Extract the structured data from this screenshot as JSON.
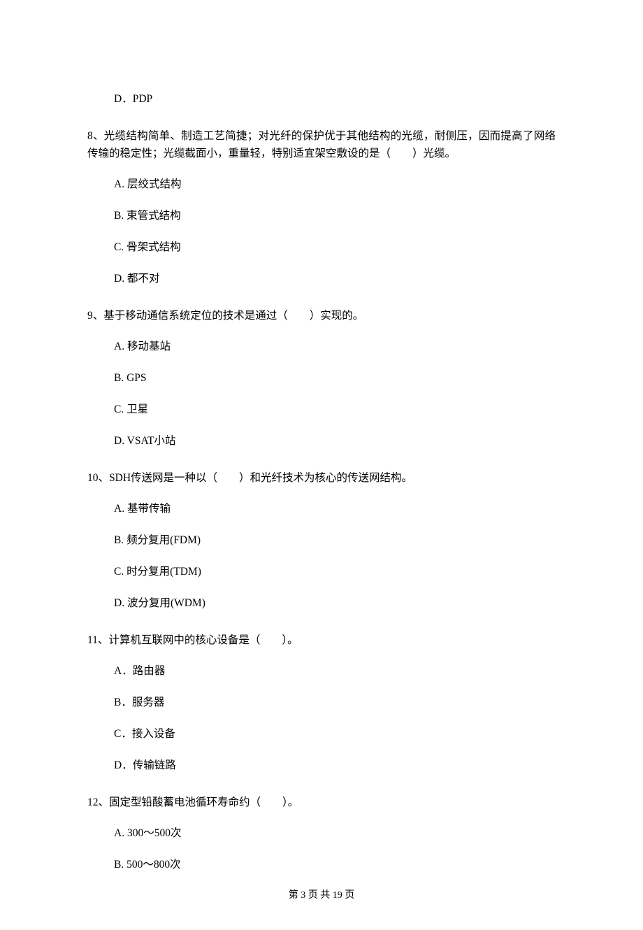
{
  "opt_d_pdp": "D．PDP",
  "q8": "8、光缆结构简单、制造工艺简捷；对光纤的保护优于其他结构的光缆，耐侧压，因而提高了网络传输的稳定性；光缆截面小，重量轻，特别适宜架空敷设的是（　　）光缆。",
  "q8_a": "A. 层绞式结构",
  "q8_b": "B. 束管式结构",
  "q8_c": "C. 骨架式结构",
  "q8_d": "D. 都不对",
  "q9": "9、基于移动通信系统定位的技术是通过（　　）实现的。",
  "q9_a": "A. 移动基站",
  "q9_b": "B. GPS",
  "q9_c": "C. 卫星",
  "q9_d": "D. VSAT小站",
  "q10": "10、SDH传送网是一种以（　　）和光纤技术为核心的传送网结构。",
  "q10_a": "A. 基带传输",
  "q10_b": "B. 频分复用(FDM)",
  "q10_c": "C. 时分复用(TDM)",
  "q10_d": "D. 波分复用(WDM)",
  "q11": "11、计算机互联网中的核心设备是（　　）。",
  "q11_a": "A．路由器",
  "q11_b": "B．服务器",
  "q11_c": "C．接入设备",
  "q11_d": "D．传输链路",
  "q12": "12、固定型铅酸蓄电池循环寿命约（　　）。",
  "q12_a": "A. 300～500次",
  "q12_b": "B. 500～800次",
  "footer": "第 3 页 共 19 页"
}
